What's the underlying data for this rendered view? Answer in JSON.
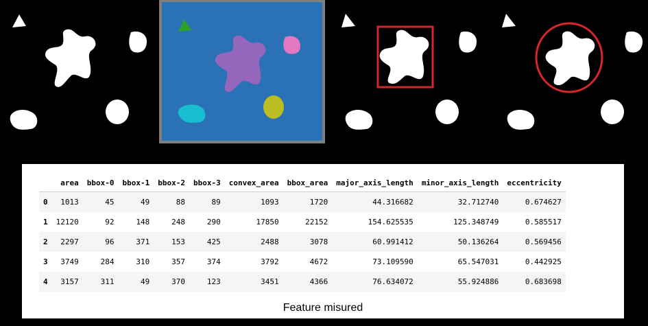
{
  "table": {
    "columns": [
      "",
      "area",
      "bbox-0",
      "bbox-1",
      "bbox-2",
      "bbox-3",
      "convex_area",
      "bbox_area",
      "major_axis_length",
      "minor_axis_length",
      "eccentricity"
    ],
    "rows": [
      [
        "0",
        "1013",
        "45",
        "49",
        "88",
        "89",
        "1093",
        "1720",
        "44.316682",
        "32.712740",
        "0.674627"
      ],
      [
        "1",
        "12120",
        "92",
        "148",
        "248",
        "290",
        "17850",
        "22152",
        "154.625535",
        "125.348749",
        "0.585517"
      ],
      [
        "2",
        "2297",
        "96",
        "371",
        "153",
        "425",
        "2488",
        "3078",
        "60.991412",
        "50.136264",
        "0.569456"
      ],
      [
        "3",
        "3749",
        "284",
        "310",
        "357",
        "374",
        "3792",
        "4672",
        "73.109590",
        "65.547031",
        "0.442925"
      ],
      [
        "4",
        "3157",
        "311",
        "49",
        "370",
        "123",
        "3451",
        "4366",
        "76.634072",
        "55.924886",
        "0.683698"
      ]
    ]
  },
  "caption": "Feature misured",
  "colors": {
    "label_background": "#2a72b5",
    "label_frame": "#7f7f7f",
    "label_triangle": "#2ca02c",
    "label_star": "#9467bd",
    "label_square": "#e377c2",
    "label_blob": "#17becf",
    "label_circle": "#bcbd22",
    "highlight": "#d62728"
  }
}
